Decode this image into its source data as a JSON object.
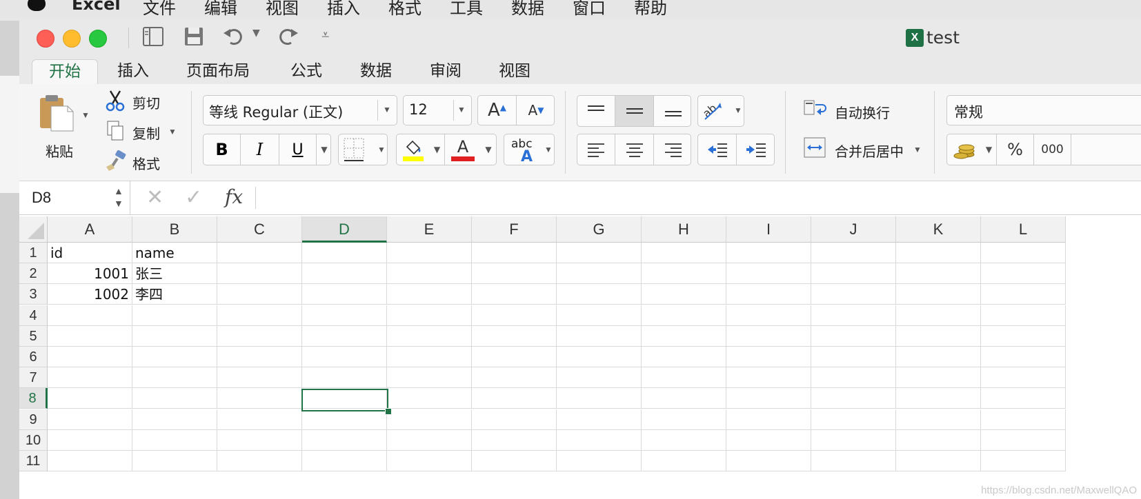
{
  "menubar": {
    "app": "Excel",
    "items": [
      "文件",
      "编辑",
      "视图",
      "插入",
      "格式",
      "工具",
      "数据",
      "窗口",
      "帮助"
    ]
  },
  "window": {
    "title": "test",
    "file_icon": "excel-file-icon"
  },
  "quick_access": [
    "sidebar-toggle-icon",
    "save-icon",
    "undo-icon",
    "redo-icon",
    "customize-icon"
  ],
  "tabs": [
    "开始",
    "插入",
    "页面布局",
    "公式",
    "数据",
    "审阅",
    "视图"
  ],
  "ribbon": {
    "paste": "粘贴",
    "cut": "剪切",
    "copy": "复制",
    "format_painter": "格式",
    "font_name": "等线 Regular (正文)",
    "font_size": "12",
    "grow_font": "A",
    "shrink_font": "A",
    "bold": "B",
    "italic": "I",
    "underline": "U",
    "font_color_glyph": "A",
    "phonetic_top": "abc",
    "phonetic_bottom": "A",
    "wrap_text": "自动换行",
    "merge_center": "合并后居中",
    "number_format": "常规",
    "percent": "%",
    "comma": "000",
    "highlight_color": "#ffff00",
    "font_color": "#e02020"
  },
  "formula_bar": {
    "name_box": "D8",
    "fx": "fx",
    "cancel": "✕",
    "enter": "✓",
    "content": ""
  },
  "sheet": {
    "columns": [
      "A",
      "B",
      "C",
      "D",
      "E",
      "F",
      "G",
      "H",
      "I",
      "J",
      "K",
      "L"
    ],
    "rows": [
      "1",
      "2",
      "3",
      "4",
      "5",
      "6",
      "7",
      "8",
      "9",
      "10",
      "11"
    ],
    "cells": [
      [
        "id",
        "name"
      ],
      [
        "1001",
        "张三"
      ],
      [
        "1002",
        "李四"
      ]
    ],
    "active_cell": "D8"
  },
  "watermark": "https://blog.csdn.net/MaxwellQAO",
  "colors": {
    "accent": "#217346"
  }
}
